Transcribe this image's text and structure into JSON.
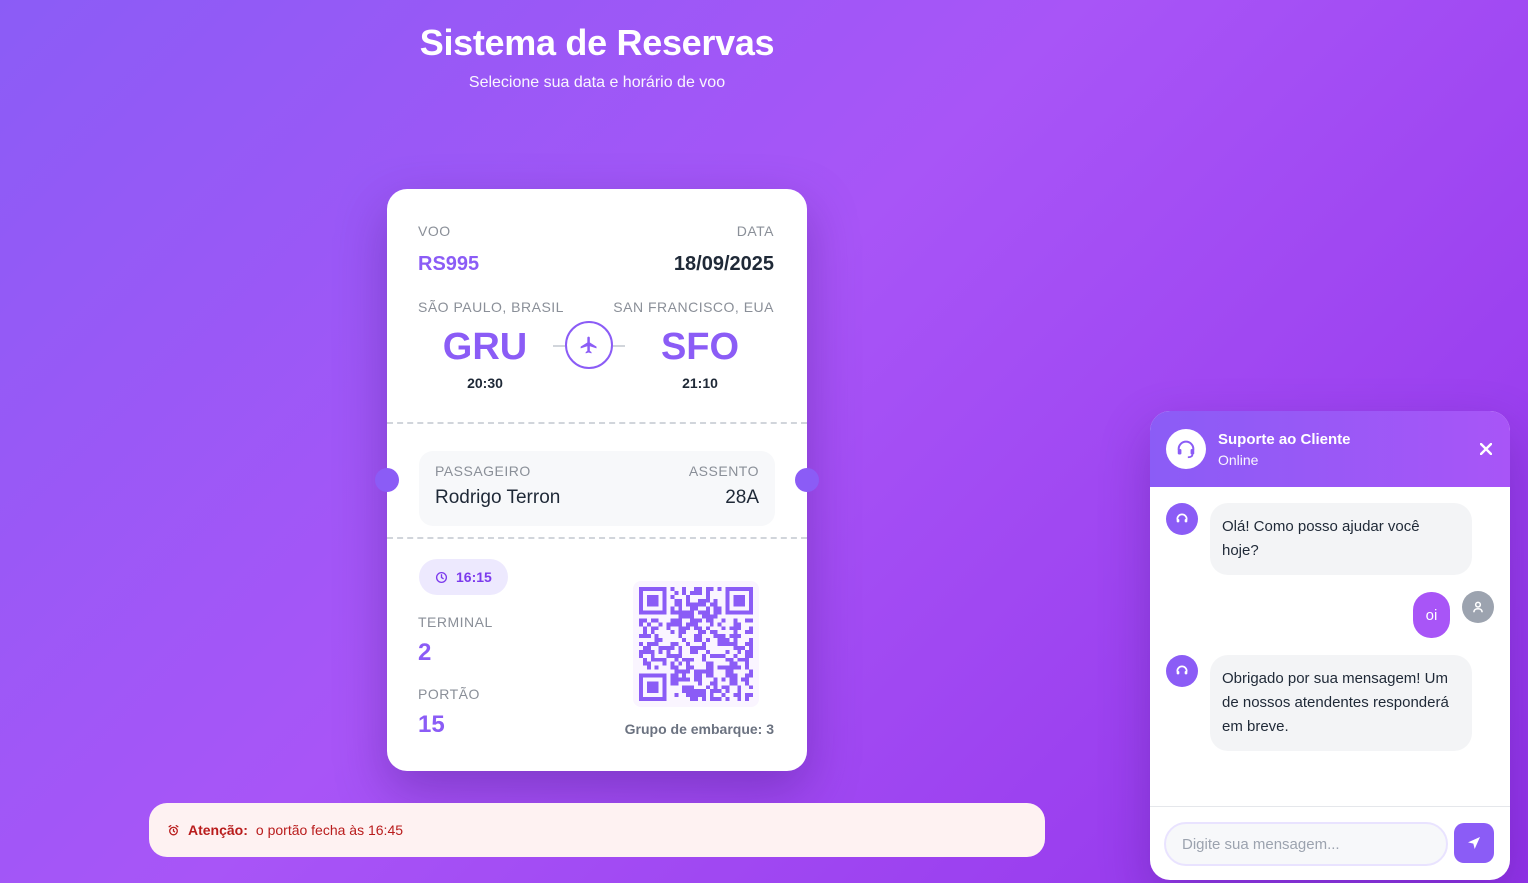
{
  "header": {
    "title": "Sistema de Reservas",
    "subtitle": "Selecione sua data e horário de voo"
  },
  "ticket": {
    "flight_label": "VOO",
    "flight_number": "RS995",
    "date_label": "DATA",
    "date": "18/09/2025",
    "origin": {
      "city": "SÃO PAULO, BRASIL",
      "code": "GRU",
      "time": "20:30"
    },
    "destination": {
      "city": "SAN FRANCISCO, EUA",
      "code": "SFO",
      "time": "21:10"
    },
    "passenger_label": "PASSAGEIRO",
    "passenger": "Rodrigo Terron",
    "seat_label": "ASSENTO",
    "seat": "28A",
    "boarding_time": "16:15",
    "terminal_label": "TERMINAL",
    "terminal": "2",
    "gate_label": "PORTÃO",
    "gate": "15",
    "boarding_group": "Grupo de embarque: 3"
  },
  "alert": {
    "strong": "Atenção:",
    "text": "o portão fecha às 16:45"
  },
  "chat": {
    "title": "Suporte ao Cliente",
    "status": "Online",
    "messages": [
      {
        "from": "bot",
        "text": "Olá! Como posso ajudar você hoje?"
      },
      {
        "from": "user",
        "text": "oi"
      },
      {
        "from": "bot",
        "text": "Obrigado por sua mensagem! Um de nossos atendentes responderá em breve."
      }
    ],
    "input_placeholder": "Digite sua mensagem..."
  },
  "colors": {
    "accent": "#8b5cf6",
    "accent_light": "#a855f7",
    "alert_text": "#b91c1c",
    "alert_bg": "#fef2f2"
  }
}
